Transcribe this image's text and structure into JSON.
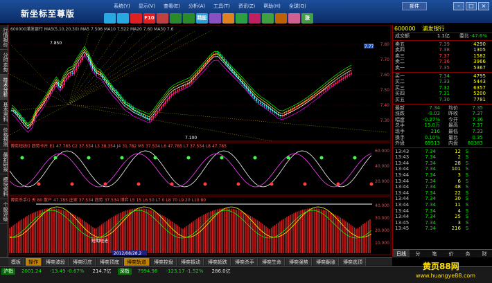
{
  "title": "新坐标至尊版",
  "menu": [
    "系统(Y)",
    "显示(V)",
    "查看(E)",
    "分析(A)",
    "工具(T)",
    "资讯(Z)",
    "帮助(H)",
    "全球(Q)"
  ],
  "buy_button": "部件",
  "toolbar": [
    {
      "t": "",
      "c": "#27a8e0"
    },
    {
      "t": "",
      "c": "#27a8e0"
    },
    {
      "t": "",
      "c": "#e02020"
    },
    {
      "t": "F10",
      "c": "#e02020"
    },
    {
      "t": "",
      "c": "#c04040"
    },
    {
      "t": "",
      "c": "#2a8a2a"
    },
    {
      "t": "",
      "c": "#2a8a2a"
    },
    {
      "t": "精股",
      "c": "#27a0d8"
    },
    {
      "t": "",
      "c": "#8850c0"
    },
    {
      "t": "",
      "c": "#e08020"
    },
    {
      "t": "",
      "c": "#2aa040"
    },
    {
      "t": "",
      "c": "#c02060"
    },
    {
      "t": "",
      "c": "#40a040"
    },
    {
      "t": "",
      "c": "#c06000"
    },
    {
      "t": "",
      "c": "#d06090"
    },
    {
      "t": "涨",
      "c": "#40a040"
    }
  ],
  "left_tabs": [
    "行情报价",
    "分时走势",
    "技术分析",
    "基本资料",
    "价格预测",
    "最新研报",
    "模块资料",
    "个股评级"
  ],
  "chart": {
    "header": "600000浦发银行  MA5(5,10,20,30)  MA5 7.506  MA10 7.522  MA20 7.60  MA30 7.6",
    "price_labels": [
      "7.80",
      "7.70",
      "7.60",
      "7.50",
      "7.40",
      "7.30"
    ],
    "hi_label": "7.850",
    "lo_label": "7.100",
    "right_tag": "7.77",
    "osc1_header": "博奕短线()  趋势卡片 E1 47.785  C2 37.534  L3 38.354  J4 31.782  M5 37.534  L6 47.785  L7 37.534  L8 47.785",
    "osc2_header": "博奕杀手()  天 80  散户 47.785  庄家 37.534  趋势 37.534  博弈  L5 15  L6 50  L7 0  L8 70  L9 20  L10 80",
    "osc1_labels": [
      "60.000",
      "40.000",
      "20.000"
    ],
    "osc2_labels": [
      "40.000",
      "30.000",
      "20.000",
      "10.000"
    ],
    "tag_stop": "短期短进",
    "date_tag": "2012/08/28,2"
  },
  "quote": {
    "code": "600000",
    "name": "浦发银行",
    "head": [
      [
        "成交额",
        "1.1亿",
        "委比",
        "-47.6%"
      ]
    ],
    "asks": [
      [
        "卖五",
        "7.39",
        "4290"
      ],
      [
        "卖四",
        "7.38",
        "1305"
      ],
      [
        "卖三",
        "7.37",
        "1582"
      ],
      [
        "卖二",
        "7.36",
        "3966"
      ],
      [
        "卖一",
        "7.35",
        "5367"
      ]
    ],
    "bids": [
      [
        "买一",
        "7.34",
        "4795"
      ],
      [
        "买二",
        "7.33",
        "5443"
      ],
      [
        "买三",
        "7.32",
        "6357"
      ],
      [
        "买四",
        "7.31",
        "5200"
      ],
      [
        "买五",
        "7.30",
        "7781"
      ]
    ],
    "stats": [
      [
        "最新",
        "7.34",
        "均价",
        "7.35"
      ],
      [
        "涨跌",
        "-0.03",
        "昨收",
        "7.37"
      ],
      [
        "幅度",
        "-0.27%",
        "今开",
        "7.36"
      ],
      [
        "总手",
        "15.0万",
        "最高",
        "7.37"
      ],
      [
        "现手",
        "216",
        "最低",
        "7.33"
      ],
      [
        "换手",
        "0.10%",
        "量比",
        "0.35"
      ],
      [
        "外盘",
        "69513",
        "内盘",
        "80383"
      ]
    ],
    "ticks": [
      [
        "13:43",
        "7.34",
        "12",
        "S"
      ],
      [
        "13:43",
        "7.34",
        "2",
        "S"
      ],
      [
        "13:44",
        "7.34",
        "28",
        "S"
      ],
      [
        "13:44",
        "7.34",
        "101",
        "S"
      ],
      [
        "13:44",
        "7.34",
        "3",
        "S"
      ],
      [
        "13:44",
        "7.34",
        "6",
        "S"
      ],
      [
        "13:44",
        "7.34",
        "48",
        "S"
      ],
      [
        "13:44",
        "7.34",
        "22",
        "S"
      ],
      [
        "13:44",
        "7.34",
        "30",
        "S"
      ],
      [
        "13:44",
        "7.34",
        "11",
        "S"
      ],
      [
        "13:44",
        "7.34",
        "4",
        "S"
      ],
      [
        "13:44",
        "7.34",
        "25",
        "S"
      ],
      [
        "13:45",
        "7.34",
        "3",
        "S"
      ],
      [
        "13:45",
        "7.34",
        "216",
        "S"
      ]
    ],
    "tabs": [
      "日线",
      "分",
      "笔",
      "价",
      "务",
      "财"
    ]
  },
  "bottom_tabs": [
    "模板",
    "操作",
    "博奕波段",
    "博奕盯庄",
    "博奕顶底",
    "博奕轨道",
    "博奕控盘",
    "博奕振动",
    "博奕超跌",
    "博奕杀手",
    "博奕生命",
    "博奕强势",
    "博奕翻涨",
    "博奕逃顶"
  ],
  "status": {
    "sh_label": "沪指",
    "sh_val": "2001.24",
    "sh_chg": "-13.49 -0.67%",
    "sh_amt": "214.7亿",
    "sz_label": "深指",
    "sz_val": "7994.98",
    "sz_chg": "-123.17 -1.52%",
    "sz_amt": "286.0亿"
  },
  "watermark": "黄页88网",
  "watermark2": "www.huangye88.com"
}
